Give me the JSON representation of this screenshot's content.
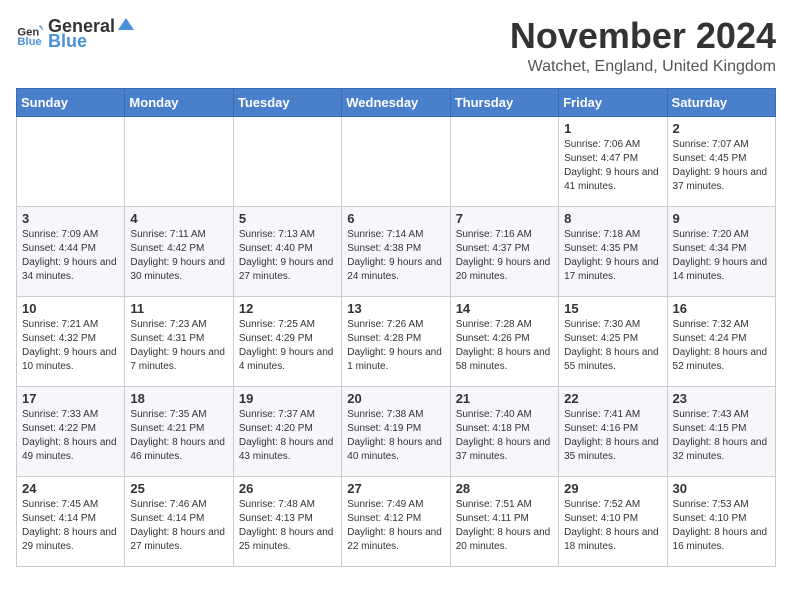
{
  "header": {
    "logo_general": "General",
    "logo_blue": "Blue",
    "month_title": "November 2024",
    "location": "Watchet, England, United Kingdom"
  },
  "days_of_week": [
    "Sunday",
    "Monday",
    "Tuesday",
    "Wednesday",
    "Thursday",
    "Friday",
    "Saturday"
  ],
  "weeks": [
    [
      {
        "day": "",
        "info": ""
      },
      {
        "day": "",
        "info": ""
      },
      {
        "day": "",
        "info": ""
      },
      {
        "day": "",
        "info": ""
      },
      {
        "day": "",
        "info": ""
      },
      {
        "day": "1",
        "info": "Sunrise: 7:06 AM\nSunset: 4:47 PM\nDaylight: 9 hours and 41 minutes."
      },
      {
        "day": "2",
        "info": "Sunrise: 7:07 AM\nSunset: 4:45 PM\nDaylight: 9 hours and 37 minutes."
      }
    ],
    [
      {
        "day": "3",
        "info": "Sunrise: 7:09 AM\nSunset: 4:44 PM\nDaylight: 9 hours and 34 minutes."
      },
      {
        "day": "4",
        "info": "Sunrise: 7:11 AM\nSunset: 4:42 PM\nDaylight: 9 hours and 30 minutes."
      },
      {
        "day": "5",
        "info": "Sunrise: 7:13 AM\nSunset: 4:40 PM\nDaylight: 9 hours and 27 minutes."
      },
      {
        "day": "6",
        "info": "Sunrise: 7:14 AM\nSunset: 4:38 PM\nDaylight: 9 hours and 24 minutes."
      },
      {
        "day": "7",
        "info": "Sunrise: 7:16 AM\nSunset: 4:37 PM\nDaylight: 9 hours and 20 minutes."
      },
      {
        "day": "8",
        "info": "Sunrise: 7:18 AM\nSunset: 4:35 PM\nDaylight: 9 hours and 17 minutes."
      },
      {
        "day": "9",
        "info": "Sunrise: 7:20 AM\nSunset: 4:34 PM\nDaylight: 9 hours and 14 minutes."
      }
    ],
    [
      {
        "day": "10",
        "info": "Sunrise: 7:21 AM\nSunset: 4:32 PM\nDaylight: 9 hours and 10 minutes."
      },
      {
        "day": "11",
        "info": "Sunrise: 7:23 AM\nSunset: 4:31 PM\nDaylight: 9 hours and 7 minutes."
      },
      {
        "day": "12",
        "info": "Sunrise: 7:25 AM\nSunset: 4:29 PM\nDaylight: 9 hours and 4 minutes."
      },
      {
        "day": "13",
        "info": "Sunrise: 7:26 AM\nSunset: 4:28 PM\nDaylight: 9 hours and 1 minute."
      },
      {
        "day": "14",
        "info": "Sunrise: 7:28 AM\nSunset: 4:26 PM\nDaylight: 8 hours and 58 minutes."
      },
      {
        "day": "15",
        "info": "Sunrise: 7:30 AM\nSunset: 4:25 PM\nDaylight: 8 hours and 55 minutes."
      },
      {
        "day": "16",
        "info": "Sunrise: 7:32 AM\nSunset: 4:24 PM\nDaylight: 8 hours and 52 minutes."
      }
    ],
    [
      {
        "day": "17",
        "info": "Sunrise: 7:33 AM\nSunset: 4:22 PM\nDaylight: 8 hours and 49 minutes."
      },
      {
        "day": "18",
        "info": "Sunrise: 7:35 AM\nSunset: 4:21 PM\nDaylight: 8 hours and 46 minutes."
      },
      {
        "day": "19",
        "info": "Sunrise: 7:37 AM\nSunset: 4:20 PM\nDaylight: 8 hours and 43 minutes."
      },
      {
        "day": "20",
        "info": "Sunrise: 7:38 AM\nSunset: 4:19 PM\nDaylight: 8 hours and 40 minutes."
      },
      {
        "day": "21",
        "info": "Sunrise: 7:40 AM\nSunset: 4:18 PM\nDaylight: 8 hours and 37 minutes."
      },
      {
        "day": "22",
        "info": "Sunrise: 7:41 AM\nSunset: 4:16 PM\nDaylight: 8 hours and 35 minutes."
      },
      {
        "day": "23",
        "info": "Sunrise: 7:43 AM\nSunset: 4:15 PM\nDaylight: 8 hours and 32 minutes."
      }
    ],
    [
      {
        "day": "24",
        "info": "Sunrise: 7:45 AM\nSunset: 4:14 PM\nDaylight: 8 hours and 29 minutes."
      },
      {
        "day": "25",
        "info": "Sunrise: 7:46 AM\nSunset: 4:14 PM\nDaylight: 8 hours and 27 minutes."
      },
      {
        "day": "26",
        "info": "Sunrise: 7:48 AM\nSunset: 4:13 PM\nDaylight: 8 hours and 25 minutes."
      },
      {
        "day": "27",
        "info": "Sunrise: 7:49 AM\nSunset: 4:12 PM\nDaylight: 8 hours and 22 minutes."
      },
      {
        "day": "28",
        "info": "Sunrise: 7:51 AM\nSunset: 4:11 PM\nDaylight: 8 hours and 20 minutes."
      },
      {
        "day": "29",
        "info": "Sunrise: 7:52 AM\nSunset: 4:10 PM\nDaylight: 8 hours and 18 minutes."
      },
      {
        "day": "30",
        "info": "Sunrise: 7:53 AM\nSunset: 4:10 PM\nDaylight: 8 hours and 16 minutes."
      }
    ]
  ]
}
